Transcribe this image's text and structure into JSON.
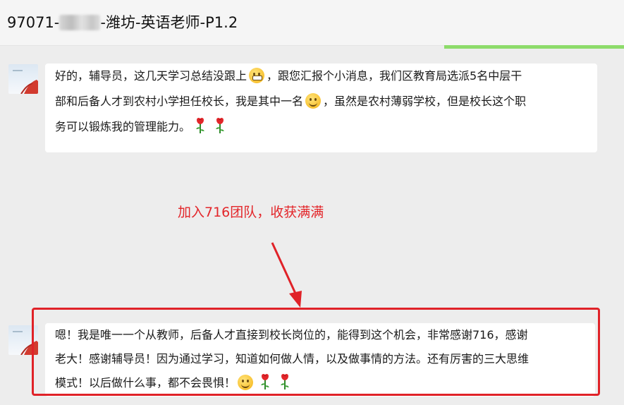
{
  "header": {
    "title_prefix": "97071-",
    "title_suffix": "-潍坊-英语老师-P1.2"
  },
  "messages": [
    {
      "lines": [
        [
          "好的，辅导员，这几天学习总结没跟上",
          "grimace-emoji",
          "，跟您汇报个小消息，我们区教育局选派5名中层干"
        ],
        [
          "部和后备人才到农村小学担任校长，我是其中一名",
          "smile-emoji",
          "，虽然是农村薄弱学校，但是校长这个职"
        ],
        [
          "务可以锻炼我的管理能力。",
          "rose-icon",
          "rose-icon"
        ]
      ]
    },
    {
      "lines": [
        [
          "嗯！我是唯一一个从教师，后备人才直接到校长岗位的，能得到这个机会，非常感谢716，感谢"
        ],
        [
          "老大！感谢辅导员！因为通过学习，知道如何做人情，以及做事情的方法。还有厉害的三大思维"
        ],
        [
          "模式！以后做什么事，都不会畏惧！",
          "smile-emoji",
          "rose-icon",
          "rose-icon"
        ]
      ]
    }
  ],
  "annotation": "加入716团队，收获满满",
  "colors": {
    "annotation": "#e3262a",
    "highlight_border": "#e02228",
    "progress": "#8ddc6a",
    "background": "#ededed"
  }
}
